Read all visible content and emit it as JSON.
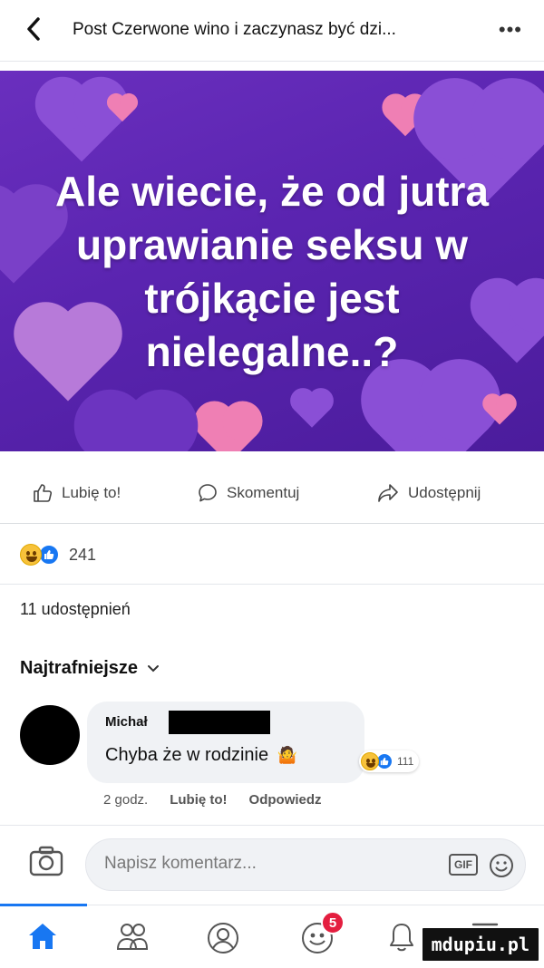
{
  "header": {
    "title": "Post Czerwone wino i zaczynasz być dzi...",
    "back_icon": "chevron-left-icon",
    "more_icon": "ellipsis-icon",
    "more_label": "•••"
  },
  "post": {
    "lines": [
      "Ale wiecie, że od jutra",
      "uprawianie seksu w",
      "trójkącie jest",
      "nielegalne..?"
    ],
    "background_color": "#5a24b0",
    "heart_colors": [
      "#8a4fd6",
      "#b77ad9",
      "#ef7fb4"
    ]
  },
  "actions": {
    "like": "Lubię to!",
    "comment": "Skomentuj",
    "share": "Udostępnij"
  },
  "reactions": {
    "count": "241",
    "types": [
      "haha",
      "like"
    ]
  },
  "shares": "11 udostępnień",
  "sort": {
    "label": "Najtrafniejsze",
    "chevron": "⌄"
  },
  "comment": {
    "author": "Michał",
    "text": "Chyba że w rodzinie",
    "emoji": "🤷",
    "reaction_count": "111",
    "time": "2 godz.",
    "like": "Lubię to!",
    "reply": "Odpowiedz"
  },
  "composer": {
    "placeholder": "Napisz komentarz...",
    "gif_label": "GIF"
  },
  "nav": {
    "items": [
      "home-icon",
      "friends-icon",
      "profile-icon",
      "groups-icon",
      "notifications-icon",
      "menu-icon"
    ],
    "badge_count": "5",
    "active_color": "#1877f2"
  },
  "watermark": "mdupiu.pl"
}
